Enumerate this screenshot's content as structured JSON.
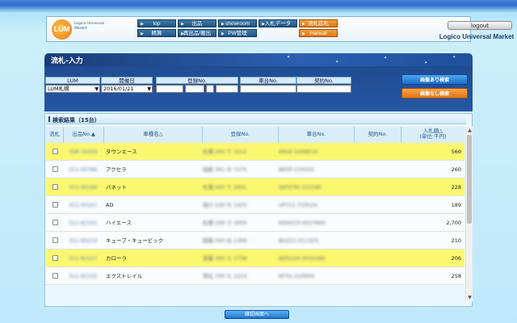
{
  "header": {
    "logo_text": "LUM",
    "logo_caption": "Logico Universal Market",
    "brand": "Logico Universal Market",
    "logout": "logout",
    "nav_row1": [
      "top",
      "出品",
      "showroom",
      "入札データ",
      "流札応札"
    ],
    "nav_row2": [
      "精算",
      "再出品/搬出",
      "PW管理",
      "manual"
    ],
    "active_nav": "流札応札",
    "accent_color": "#1f4c92",
    "highlight_color": "#fbf870"
  },
  "page": {
    "title": "流札-入力"
  },
  "search": {
    "labels": {
      "lum": "LUM",
      "date": "開催日",
      "reg": "登録No.",
      "chassis": "車台No.",
      "contract": "契約No."
    },
    "lum_value": "LUM札幌",
    "date_value": "2016/01/21",
    "btn_with_image": "画像あり検索",
    "btn_without_image": "画像なし検索"
  },
  "results": {
    "title": "検索結果（15台）",
    "columns": {
      "flow": "流札",
      "lot": "出品No.▲",
      "car": "車種名△",
      "reg": "登録No.",
      "chassis": "車台No.",
      "contract": "契約No.",
      "price_line1": "入札額△",
      "price_line2": "(単位:千円)"
    },
    "rows": [
      {
        "lot": "338-10056",
        "car": "タウンエース",
        "reg": "札幌 400 て 3212",
        "chassis": "KR42-5009016",
        "price": "560",
        "highlight": true
      },
      {
        "lot": "311-00786",
        "car": "アクセラ",
        "reg": "函館 301 せ 7275",
        "chassis": "BK5P-215555",
        "price": "260",
        "highlight": false
      },
      {
        "lot": "311-00166",
        "car": "パネット",
        "reg": "札幌 400 て 2601",
        "chassis": "SKP2TN-101596",
        "price": "228",
        "highlight": true
      },
      {
        "lot": "311-00167",
        "car": "AD",
        "reg": "旭川 430 ち 1425",
        "chassis": "VFY11-733024",
        "price": "189",
        "highlight": false
      },
      {
        "lot": "311-62101",
        "car": "ハイエース",
        "reg": "札幌 200 さ 2005",
        "chassis": "KDH223-0027865",
        "price": "2,700",
        "highlight": false
      },
      {
        "lot": "311-60214",
        "car": "キューブ・キュービック",
        "reg": "釧路 500 ね 1389",
        "chassis": "BGZ11-011325",
        "price": "210",
        "highlight": false
      },
      {
        "lot": "311-62157",
        "car": "カローラ",
        "reg": "室蘭 300 ら 3736",
        "chassis": "NZE124-2032189",
        "price": "206",
        "highlight": true
      },
      {
        "lot": "311-62102",
        "car": "エクストレイル",
        "reg": "帯広 330 た 1215",
        "chassis": "NT31-210004",
        "price": "258",
        "highlight": false
      }
    ]
  },
  "footer": {
    "confirm": "確認画面へ"
  }
}
